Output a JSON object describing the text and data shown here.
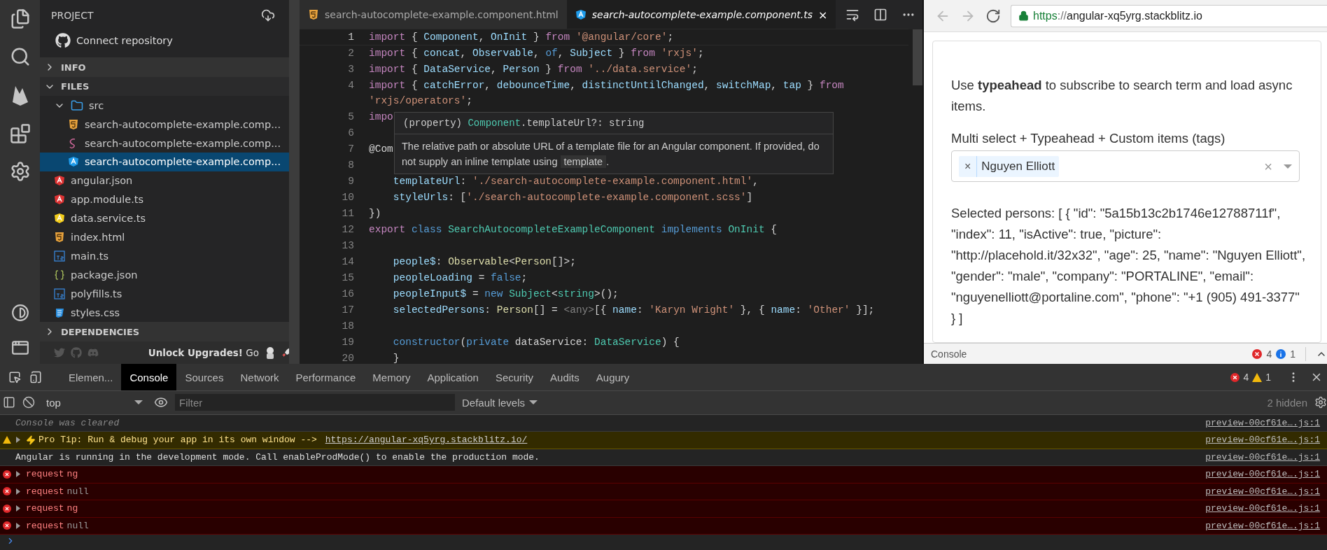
{
  "sidebar": {
    "title": "PROJECT",
    "connect": "Connect repository",
    "sections": [
      {
        "label": "INFO",
        "expanded": false
      },
      {
        "label": "FILES",
        "expanded": true
      }
    ],
    "files": [
      {
        "name": "src",
        "kind": "folder",
        "expanded": true,
        "selected": false,
        "children": [
          {
            "name": "search-autocomplete-example.comp...",
            "kind": "html",
            "selected": false
          },
          {
            "name": "search-autocomplete-example.comp...",
            "kind": "sass",
            "selected": false
          },
          {
            "name": "search-autocomplete-example.comp...",
            "kind": "angular-blue",
            "selected": true
          }
        ]
      },
      {
        "name": "angular.json",
        "kind": "angular-red",
        "selected": false
      },
      {
        "name": "app.module.ts",
        "kind": "angular-red",
        "selected": false
      },
      {
        "name": "data.service.ts",
        "kind": "angular-yellow",
        "selected": false
      },
      {
        "name": "index.html",
        "kind": "html",
        "selected": false
      },
      {
        "name": "main.ts",
        "kind": "ts",
        "selected": false
      },
      {
        "name": "package.json",
        "kind": "json",
        "selected": false
      },
      {
        "name": "polyfills.ts",
        "kind": "ts",
        "selected": false
      },
      {
        "name": "styles.css",
        "kind": "css",
        "selected": false
      }
    ],
    "dependencies": {
      "label": "DEPENDENCIES",
      "expanded": false
    },
    "footer": "**Unlock Upgrades!** Go"
  },
  "editor": {
    "tabs": [
      {
        "label": "search-autocomplete-example.component.html",
        "kind": "html",
        "selected": false
      },
      {
        "label": "search-autocomplete-example.component.ts",
        "kind": "angular-blue",
        "selected": true,
        "close": "×"
      }
    ],
    "lines": [
      {
        "number": "1",
        "current": true,
        "tokens": [
          {
            "text": "import",
            "kind": "kw"
          },
          {
            "text": " { ",
            "kind": "p"
          },
          {
            "text": "Component",
            "kind": "id"
          },
          {
            "text": ", ",
            "kind": "p"
          },
          {
            "text": "OnInit",
            "kind": "id"
          },
          {
            "text": " } ",
            "kind": "p"
          },
          {
            "text": "from",
            "kind": "kw"
          },
          {
            "text": " '@angular/core'",
            "kind": "str"
          },
          {
            "text": ";",
            "kind": "p"
          }
        ]
      },
      {
        "number": "2",
        "current": false,
        "tokens": [
          {
            "text": "import",
            "kind": "kw"
          },
          {
            "text": " { ",
            "kind": "p"
          },
          {
            "text": "concat",
            "kind": "id"
          },
          {
            "text": ", ",
            "kind": "p"
          },
          {
            "text": "Observable",
            "kind": "id"
          },
          {
            "text": ", ",
            "kind": "p"
          },
          {
            "text": "of",
            "kind": "blue"
          },
          {
            "text": ", ",
            "kind": "p"
          },
          {
            "text": "Subject",
            "kind": "id"
          },
          {
            "text": " } ",
            "kind": "p"
          },
          {
            "text": "from",
            "kind": "kw"
          },
          {
            "text": " 'rxjs'",
            "kind": "str"
          },
          {
            "text": ";",
            "kind": "p"
          }
        ]
      },
      {
        "number": "3",
        "current": false,
        "tokens": [
          {
            "text": "import",
            "kind": "kw"
          },
          {
            "text": " { ",
            "kind": "p"
          },
          {
            "text": "DataService",
            "kind": "id"
          },
          {
            "text": ", ",
            "kind": "p"
          },
          {
            "text": "Person",
            "kind": "id"
          },
          {
            "text": " } ",
            "kind": "p"
          },
          {
            "text": "from",
            "kind": "kw"
          },
          {
            "text": " '../data.service'",
            "kind": "str"
          },
          {
            "text": ";",
            "kind": "p"
          }
        ]
      },
      {
        "number": "4",
        "current": false,
        "tokens": [
          {
            "text": "import",
            "kind": "kw"
          },
          {
            "text": " { ",
            "kind": "p"
          },
          {
            "text": "catchError",
            "kind": "id"
          },
          {
            "text": ", ",
            "kind": "p"
          },
          {
            "text": "debounceTime",
            "kind": "id"
          },
          {
            "text": ", ",
            "kind": "p"
          },
          {
            "text": "distinctUntilChanged",
            "kind": "id"
          },
          {
            "text": ", ",
            "kind": "p"
          },
          {
            "text": "switchMap",
            "kind": "id"
          },
          {
            "text": ", ",
            "kind": "p"
          },
          {
            "text": "tap",
            "kind": "id"
          },
          {
            "text": " } ",
            "kind": "p"
          },
          {
            "text": "from",
            "kind": "kw"
          },
          {
            "text": " 'rxjs/operators'",
            "kind": "str"
          },
          {
            "text": ";",
            "kind": "p"
          }
        ]
      },
      {
        "number": "5",
        "current": false,
        "tokens": [
          {
            "text": "impo",
            "kind": "kw"
          }
        ]
      },
      {
        "number": "6",
        "current": false
      },
      {
        "number": "7",
        "current": false,
        "tokens": [
          {
            "text": "@Com",
            "kind": "p"
          }
        ]
      },
      {
        "number": "8",
        "current": false
      },
      {
        "number": "9",
        "current": false,
        "tokens": [
          {
            "text": "    templateUrl",
            "kind": "id"
          },
          {
            "text": ": ",
            "kind": "p"
          },
          {
            "text": "'./search-autocomplete-example.component.html'",
            "kind": "str"
          },
          {
            "text": ",",
            "kind": "p"
          }
        ]
      },
      {
        "number": "10",
        "current": false,
        "tokens": [
          {
            "text": "    styleUrls",
            "kind": "id"
          },
          {
            "text": ": [",
            "kind": "p"
          },
          {
            "text": "'./search-autocomplete-example.component.scss'",
            "kind": "str"
          },
          {
            "text": "]",
            "kind": "p"
          }
        ]
      },
      {
        "number": "11",
        "current": false,
        "tokens": [
          {
            "text": "})",
            "kind": "p"
          }
        ]
      },
      {
        "number": "12",
        "current": false,
        "tokens": [
          {
            "text": "export",
            "kind": "kw"
          },
          {
            "text": " class",
            "kind": "blue"
          },
          {
            "text": " SearchAutocompleteExampleComponent",
            "kind": "type"
          },
          {
            "text": " implements",
            "kind": "blue"
          },
          {
            "text": " OnInit",
            "kind": "type"
          },
          {
            "text": " {",
            "kind": "p"
          }
        ]
      },
      {
        "number": "13",
        "current": false
      },
      {
        "number": "14",
        "current": false,
        "tokens": [
          {
            "text": "    people$",
            "kind": "id"
          },
          {
            "text": ": ",
            "kind": "p"
          },
          {
            "text": "Observable",
            "kind": "yel"
          },
          {
            "text": "<",
            "kind": "p"
          },
          {
            "text": "Person",
            "kind": "yel"
          },
          {
            "text": "[]>;",
            "kind": "p"
          }
        ]
      },
      {
        "number": "15",
        "current": false,
        "tokens": [
          {
            "text": "    peopleLoading",
            "kind": "id"
          },
          {
            "text": " = ",
            "kind": "p"
          },
          {
            "text": "false",
            "kind": "blue"
          },
          {
            "text": ";",
            "kind": "p"
          }
        ]
      },
      {
        "number": "16",
        "current": false,
        "tokens": [
          {
            "text": "    peopleInput$",
            "kind": "id"
          },
          {
            "text": " = ",
            "kind": "p"
          },
          {
            "text": "new",
            "kind": "blue"
          },
          {
            "text": " Subject",
            "kind": "type"
          },
          {
            "text": "<",
            "kind": "p"
          },
          {
            "text": "string",
            "kind": "type"
          },
          {
            "text": ">();",
            "kind": "p"
          }
        ]
      },
      {
        "number": "17",
        "current": false,
        "tokens": [
          {
            "text": "    selectedPersons",
            "kind": "id"
          },
          {
            "text": ": ",
            "kind": "p"
          },
          {
            "text": "Person",
            "kind": "yel"
          },
          {
            "text": "[] = ",
            "kind": "p"
          },
          {
            "text": "<any>",
            "kind": "gray"
          },
          {
            "text": "[{ ",
            "kind": "p"
          },
          {
            "text": "name",
            "kind": "id"
          },
          {
            "text": ": ",
            "kind": "p"
          },
          {
            "text": "'Karyn Wright'",
            "kind": "str"
          },
          {
            "text": " }, { ",
            "kind": "p"
          },
          {
            "text": "name",
            "kind": "id"
          },
          {
            "text": ": ",
            "kind": "p"
          },
          {
            "text": "'Other'",
            "kind": "str"
          },
          {
            "text": " }];",
            "kind": "p"
          }
        ]
      },
      {
        "number": "18",
        "current": false
      },
      {
        "number": "19",
        "current": false,
        "tokens": [
          {
            "text": "    constructor",
            "kind": "blue"
          },
          {
            "text": "(",
            "kind": "p"
          },
          {
            "text": "private",
            "kind": "blue"
          },
          {
            "text": " dataService: ",
            "kind": "p"
          },
          {
            "text": "DataService",
            "kind": "type"
          },
          {
            "text": ") {",
            "kind": "p"
          }
        ]
      },
      {
        "number": "20",
        "current": false,
        "tokens": [
          {
            "text": "    }",
            "kind": "p"
          }
        ]
      }
    ],
    "tooltip": {
      "prefix": "(property) ",
      "name": "Component",
      "rest": ".templateUrl?: string",
      "doc": "The relative path or absolute URL of a template file for an Angular component. If provided, do not supply an inline template using ",
      "code": "template",
      "end": "."
    }
  },
  "preview": {
    "url_scheme": "https",
    "url_rest": "://angular-xq5yrg.stackblitz.io",
    "intro": "Use **typeahead** to subscribe to search term and load async items.",
    "select_label": "Multi select + Typeahead + Custom items (tags)",
    "tags": [
      {
        "remove": "×",
        "label": "Nguyen Elliott"
      }
    ],
    "clear": "×",
    "selected_text": "Selected persons: [ { \"id\": \"5a15b13c2b1746e12788711f\", \"index\": 11, \"isActive\": true, \"picture\": \"http://placehold.it/32x32\", \"age\": 25, \"name\": \"Nguyen Elliott\", \"gender\": \"male\", \"company\": \"PORTALINE\", \"email\": \"nguyenelliott@portaline.com\", \"phone\": \"+1 (905) 491-3377\" } ]",
    "console": {
      "label": "Console",
      "errors": "4",
      "infos": "1"
    }
  },
  "devtools": {
    "tabs": [
      {
        "label": "Elemen...",
        "selected": false
      },
      {
        "label": "Console",
        "selected": true
      },
      {
        "label": "Sources",
        "selected": false
      },
      {
        "label": "Network",
        "selected": false
      },
      {
        "label": "Performance",
        "selected": false
      },
      {
        "label": "Memory",
        "selected": false
      },
      {
        "label": "Application",
        "selected": false
      },
      {
        "label": "Security",
        "selected": false
      },
      {
        "label": "Audits",
        "selected": false
      },
      {
        "label": "Augury",
        "selected": false
      }
    ],
    "errors": "4",
    "warnings": "1",
    "context": "top",
    "filter_placeholder": "Filter",
    "levels": "Default levels",
    "hidden": "2 hidden",
    "messages": [
      {
        "kind": "cleared",
        "text": "Console was cleared",
        "source": "preview-00cf61e….js:1"
      },
      {
        "kind": "warning",
        "text": "Pro Tip: Run & debug your app in its own window --> ",
        "link": "https://angular-xq5yrg.stackblitz.io/",
        "source": "preview-00cf61e….js:1"
      },
      {
        "kind": "info",
        "text": "Angular is running in the development mode. Call enableProdMode() to enable the production mode.",
        "source": "preview-00cf61e….js:1"
      },
      {
        "kind": "error",
        "text": "request",
        "value": "ng",
        "value_dimmed": false,
        "source": "preview-00cf61e….js:1"
      },
      {
        "kind": "error",
        "text": "request",
        "value": "null",
        "value_dimmed": true,
        "source": "preview-00cf61e….js:1"
      },
      {
        "kind": "error",
        "text": "request",
        "value": "ng",
        "value_dimmed": false,
        "source": "preview-00cf61e….js:1"
      },
      {
        "kind": "error",
        "text": "request",
        "value": "null",
        "value_dimmed": true,
        "source": "preview-00cf61e….js:1"
      }
    ]
  }
}
